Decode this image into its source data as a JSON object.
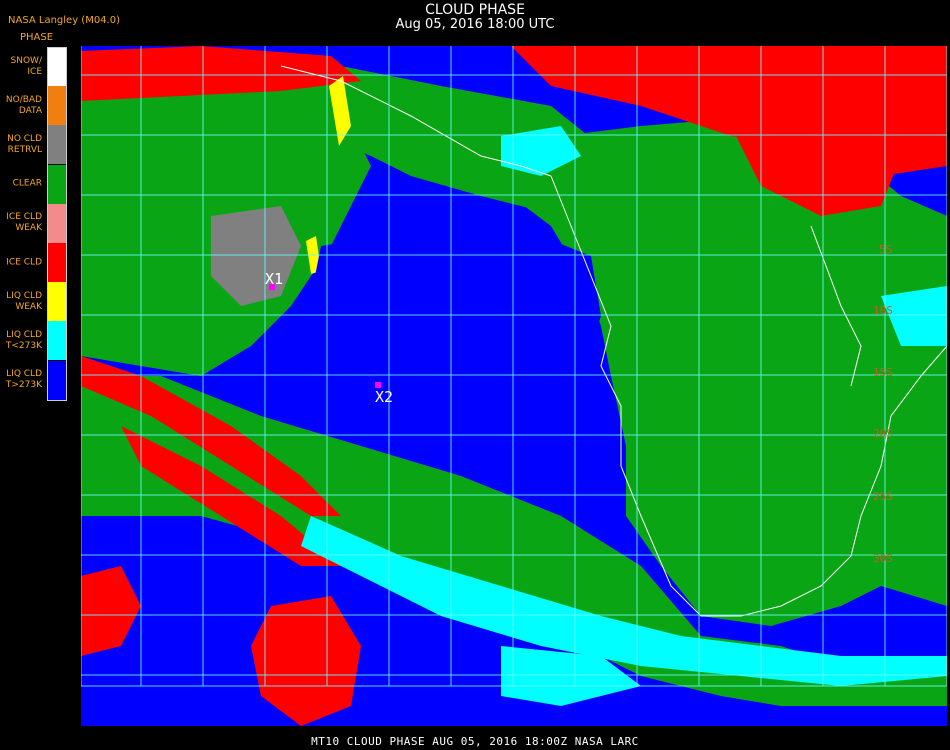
{
  "header": {
    "title": "CLOUD PHASE",
    "subtitle": "Aug 05, 2016 18:00 UTC",
    "agency": "NASA Langley (M04.0)"
  },
  "legend": {
    "title": "PHASE",
    "items": [
      {
        "label": "SNOW/\nICE",
        "color": "#ffffff"
      },
      {
        "label": "NO/BAD\nDATA",
        "color": "#f07f10"
      },
      {
        "label": "NO CLD\nRETRVL",
        "color": "#808080"
      },
      {
        "label": "CLEAR",
        "color": "#0aa514"
      },
      {
        "label": "ICE CLD\nWEAK",
        "color": "#f28c8c"
      },
      {
        "label": "ICE CLD",
        "color": "#ff0000"
      },
      {
        "label": "LIQ CLD\nWEAK",
        "color": "#ffff00"
      },
      {
        "label": "LIQ CLD\nT<273K",
        "color": "#00ffff"
      },
      {
        "label": "LIQ CLD\nT>273K",
        "color": "#0000ff"
      }
    ]
  },
  "map": {
    "markers": [
      {
        "label": "X1"
      },
      {
        "label": "X2"
      }
    ],
    "lat_labels": [
      "5S",
      "10S",
      "15S",
      "20S",
      "25S",
      "30S"
    ]
  },
  "footer": "MT10   CLOUD PHASE    AUG 05, 2016 18:00Z   NASA LARC"
}
